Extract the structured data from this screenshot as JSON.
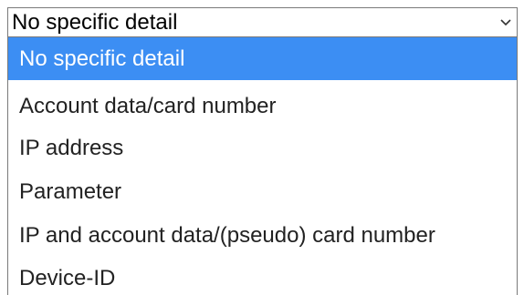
{
  "select": {
    "value": "No specific detail",
    "arrow_icon": "chevron-down-icon",
    "options": [
      {
        "label": "No specific detail",
        "selected": true
      },
      {
        "label": "Account data/card number",
        "selected": false
      },
      {
        "label": "IP address",
        "selected": false
      },
      {
        "label": "Parameter",
        "selected": false
      },
      {
        "label": "IP and account data/(pseudo) card number",
        "selected": false
      },
      {
        "label": "Device-ID",
        "selected": false
      }
    ]
  },
  "colors": {
    "highlight": "#3c8ef3",
    "border": "#7a7a7a",
    "text": "#222222"
  }
}
